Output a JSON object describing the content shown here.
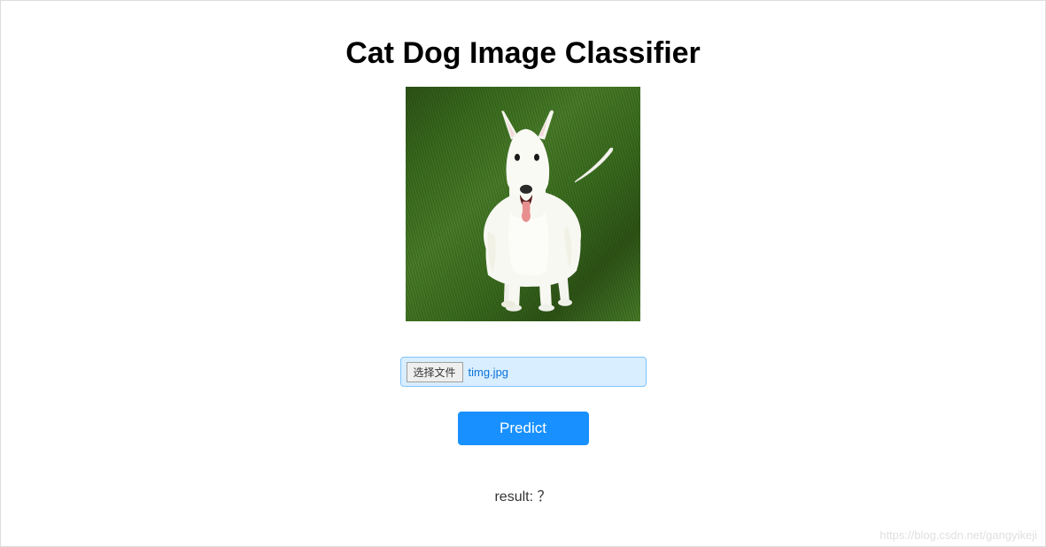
{
  "header": {
    "title": "Cat Dog Image Classifier"
  },
  "preview": {
    "alt": "dog-on-grass"
  },
  "file_input": {
    "button_label": "选择文件",
    "selected_filename": "timg.jpg"
  },
  "actions": {
    "predict_label": "Predict"
  },
  "result": {
    "label": "result:",
    "value": "？"
  },
  "watermark": "https://blog.csdn.net/gangyikeji"
}
